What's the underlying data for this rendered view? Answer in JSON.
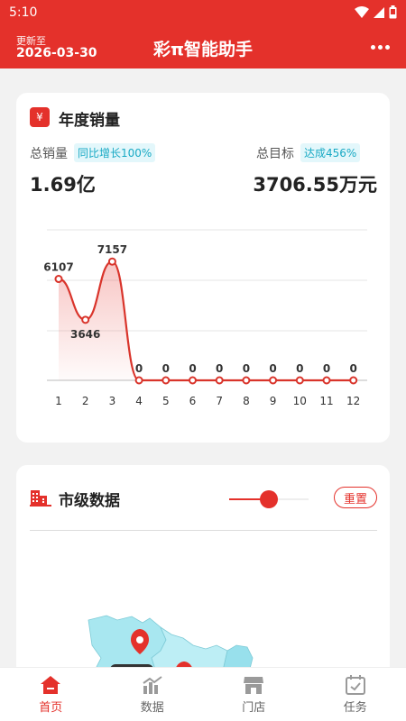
{
  "status_bar": {
    "time": "5:10"
  },
  "header": {
    "update_label": "更新至",
    "update_date": "2026-03-30",
    "title": "彩π智能助手"
  },
  "sales_card": {
    "icon_symbol": "¥",
    "title": "年度销量",
    "total_label": "总销量",
    "total_badge": "同比增长100%",
    "total_value": "1.69亿",
    "target_label": "总目标",
    "target_badge": "达成456%",
    "target_value": "3706.55万元"
  },
  "chart_data": {
    "type": "line",
    "categories": [
      "1",
      "2",
      "3",
      "4",
      "5",
      "6",
      "7",
      "8",
      "9",
      "10",
      "11",
      "12"
    ],
    "values": [
      6107,
      3646,
      7157,
      0,
      0,
      0,
      0,
      0,
      0,
      0,
      0,
      0
    ],
    "ylim": [
      0,
      6000
    ],
    "grid": true,
    "color": "#d9342b"
  },
  "city_card": {
    "title": "市级数据",
    "reset_label": "重置",
    "slider_value": 0.5
  },
  "tabs": [
    {
      "label": "首页",
      "icon": "home-icon",
      "active": true
    },
    {
      "label": "数据",
      "icon": "chart-bar-icon",
      "active": false
    },
    {
      "label": "门店",
      "icon": "store-icon",
      "active": false
    },
    {
      "label": "任务",
      "icon": "task-calendar-icon",
      "active": false
    }
  ],
  "colors": {
    "primary": "#e4312b",
    "accent": "#18a9c4",
    "inactive": "#9a9a9a"
  }
}
